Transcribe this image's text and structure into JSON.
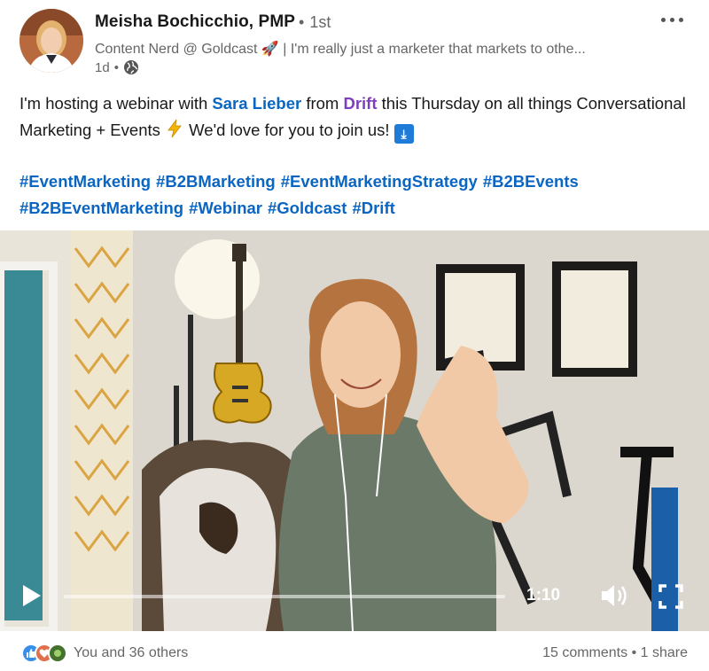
{
  "post": {
    "author": {
      "name": "Meisha Bochicchio, PMP",
      "degree": "1st",
      "headline": "Content Nerd @ Goldcast 🚀 | I'm really just a marketer that markets to othe...",
      "time": "1d",
      "visibility_icon": "globe-icon"
    },
    "text": {
      "part1": "I'm hosting a webinar with ",
      "mention_person": "Sara Lieber",
      "part2": " from ",
      "mention_company": "Drift",
      "part3": " this Thursday on all things Conversational Marketing + Events ",
      "part4": " We'd love for you to join us! "
    },
    "hashtags": [
      "#EventMarketing",
      "#B2BMarketing",
      "#EventMarketingStrategy",
      "#B2BEvents",
      "#B2BEventMarketing",
      "#Webinar",
      "#Goldcast",
      "#Drift"
    ],
    "video": {
      "time": "1:10",
      "progress": 0.0
    },
    "social": {
      "reactions_label": "You and 36 others",
      "comments": "15 comments",
      "separator": " • ",
      "shares": "1 share"
    },
    "colors": {
      "link": "#0a66c2",
      "company": "#7e3fbf",
      "muted": "#666666"
    }
  }
}
